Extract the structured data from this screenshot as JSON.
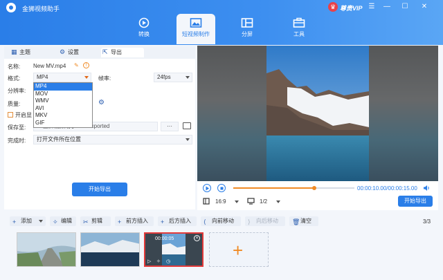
{
  "app": {
    "title": "金狮视频助手",
    "vip_label": "尊贵VIP"
  },
  "window_controls": [
    "☰",
    "—",
    "☐",
    "✕"
  ],
  "nav": [
    {
      "label": "转换",
      "icon": "convert-icon"
    },
    {
      "label": "短视频制作",
      "icon": "short-video-icon",
      "active": true
    },
    {
      "label": "分屏",
      "icon": "split-screen-icon"
    },
    {
      "label": "工具",
      "icon": "toolbox-icon"
    }
  ],
  "tabs": [
    {
      "label": "主题",
      "icon": "grid-icon"
    },
    {
      "label": "设置",
      "icon": "gear-icon"
    },
    {
      "label": "导出",
      "icon": "export-icon",
      "active": true
    }
  ],
  "export_form": {
    "name_label": "名称:",
    "name_value": "New MV.mp4",
    "format_label": "格式:",
    "format_value": "MP4",
    "framerate_label": "帧率:",
    "framerate_value": "24fps",
    "resolution_label": "分辨率:",
    "quality_label": "质量:",
    "gpu_label": "开启显",
    "save_label": "保存至:",
    "save_path": "...\\金狮视频助手\\MV Exported",
    "more_label": "···",
    "complete_label": "完成时:",
    "complete_value": "打开文件所在位置",
    "export_button": "开始导出"
  },
  "format_options": [
    "MP4",
    "MOV",
    "WMV",
    "AVI",
    "MKV",
    "GIF"
  ],
  "player": {
    "current_time": "00:00:10.00",
    "total_time": "00:00:15.00",
    "progress_fraction": 0.667,
    "aspect": "16:9",
    "page": "1/2",
    "export_button": "开始导出"
  },
  "toolbar": {
    "add": "添加",
    "edit": "编辑",
    "cut": "剪辑",
    "insert_before": "前方插入",
    "insert_after": "后方插入",
    "move_forward": "向前移动",
    "move_back": "向后移动",
    "clear": "清空",
    "count": "3/3"
  },
  "clips": [
    {
      "label": "",
      "selected": false
    },
    {
      "label": "",
      "selected": false
    },
    {
      "label": "00:00:05",
      "selected": true
    }
  ],
  "colors": {
    "primary": "#2a7ee8",
    "accent": "#f08a24",
    "selected": "#e43a3a"
  }
}
